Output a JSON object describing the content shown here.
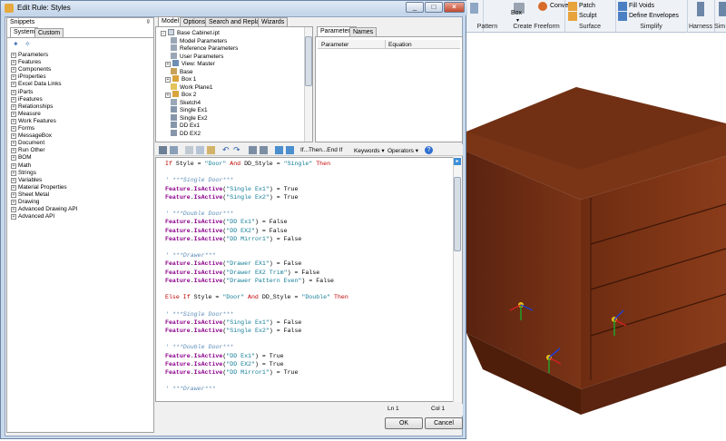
{
  "window": {
    "title": "Edit Rule: Styles"
  },
  "snippets": {
    "header": "Snippets",
    "tabs": [
      "System",
      "Custom"
    ],
    "items": [
      "Parameters",
      "Features",
      "Components",
      "iProperties",
      "Excel Data Links",
      "iParts",
      "iFeatures",
      "Relationships",
      "Measure",
      "Work Features",
      "Forms",
      "MessageBox",
      "Document",
      "Run Other",
      "BOM",
      "Math",
      "Strings",
      "Variables",
      "Material Properties",
      "Sheet Metal",
      "Drawing",
      "Advanced Drawing API",
      "Advanced API"
    ]
  },
  "main_tabs": [
    "Model",
    "Options",
    "Search and Replace",
    "Wizards"
  ],
  "model_tree": {
    "root": "Base Cabinet.ipt",
    "items": [
      "Model Parameters",
      "Reference Parameters",
      "User Parameters",
      "View: Master",
      "Base",
      "Box 1",
      "Work Plane1",
      "Box 2",
      "Sketch4",
      "Single Ex1",
      "Single Ex2",
      "DD Ex1",
      "DD EX2"
    ]
  },
  "param_panel": {
    "tabs": [
      "Parameters",
      "Names"
    ],
    "columns": [
      "Parameter",
      "Equation"
    ]
  },
  "toolbar": {
    "if_then": "If...Then...End If",
    "keywords": "Keywords",
    "operators": "Operators"
  },
  "code": [
    [
      [
        "kw",
        "If "
      ],
      [
        "plain",
        "Style = "
      ],
      [
        "str",
        "\"Door\""
      ],
      [
        "kw",
        " And "
      ],
      [
        "plain",
        "DD_Style = "
      ],
      [
        "str",
        "\"Single\""
      ],
      [
        "kw",
        " Then"
      ]
    ],
    [],
    [
      [
        "cmt",
        "' ***Single Door***"
      ]
    ],
    [
      [
        "obj",
        "Feature"
      ],
      [
        "plain",
        "."
      ],
      [
        "obj",
        "IsActive"
      ],
      [
        "plain",
        "("
      ],
      [
        "str",
        "\"Single Ex1\""
      ],
      [
        "plain",
        ") = True"
      ]
    ],
    [
      [
        "obj",
        "Feature"
      ],
      [
        "plain",
        "."
      ],
      [
        "obj",
        "IsActive"
      ],
      [
        "plain",
        "("
      ],
      [
        "str",
        "\"Single Ex2\""
      ],
      [
        "plain",
        ") = True"
      ]
    ],
    [],
    [
      [
        "cmt",
        "' ***Double Door***"
      ]
    ],
    [
      [
        "obj",
        "Feature"
      ],
      [
        "plain",
        "."
      ],
      [
        "obj",
        "IsActive"
      ],
      [
        "plain",
        "("
      ],
      [
        "str",
        "\"DD Ex1\""
      ],
      [
        "plain",
        ") = False"
      ]
    ],
    [
      [
        "obj",
        "Feature"
      ],
      [
        "plain",
        "."
      ],
      [
        "obj",
        "IsActive"
      ],
      [
        "plain",
        "("
      ],
      [
        "str",
        "\"DD EX2\""
      ],
      [
        "plain",
        ") = False"
      ]
    ],
    [
      [
        "obj",
        "Feature"
      ],
      [
        "plain",
        "."
      ],
      [
        "obj",
        "IsActive"
      ],
      [
        "plain",
        "("
      ],
      [
        "str",
        "\"DD Mirror1\""
      ],
      [
        "plain",
        ") = False"
      ]
    ],
    [],
    [
      [
        "cmt",
        "' ***Drawer***"
      ]
    ],
    [
      [
        "obj",
        "Feature"
      ],
      [
        "plain",
        "."
      ],
      [
        "obj",
        "IsActive"
      ],
      [
        "plain",
        "("
      ],
      [
        "str",
        "\"Drawer EX1\""
      ],
      [
        "plain",
        ") = False"
      ]
    ],
    [
      [
        "obj",
        "Feature"
      ],
      [
        "plain",
        "."
      ],
      [
        "obj",
        "IsActive"
      ],
      [
        "plain",
        "("
      ],
      [
        "str",
        "\"Drawer EX2 Trim\""
      ],
      [
        "plain",
        ") = False"
      ]
    ],
    [
      [
        "obj",
        "Feature"
      ],
      [
        "plain",
        "."
      ],
      [
        "obj",
        "IsActive"
      ],
      [
        "plain",
        "("
      ],
      [
        "str",
        "\"Drawer Pattern Even\""
      ],
      [
        "plain",
        ") = False"
      ]
    ],
    [],
    [
      [
        "kw",
        "Else If "
      ],
      [
        "plain",
        "Style = "
      ],
      [
        "str",
        "\"Door\""
      ],
      [
        "kw",
        " And "
      ],
      [
        "plain",
        "DD_Style = "
      ],
      [
        "str",
        "\"Double\""
      ],
      [
        "kw",
        " Then"
      ]
    ],
    [],
    [
      [
        "cmt",
        "' ***Single Door***"
      ]
    ],
    [
      [
        "obj",
        "Feature"
      ],
      [
        "plain",
        "."
      ],
      [
        "obj",
        "IsActive"
      ],
      [
        "plain",
        "("
      ],
      [
        "str",
        "\"Single Ex1\""
      ],
      [
        "plain",
        ") = False"
      ]
    ],
    [
      [
        "obj",
        "Feature"
      ],
      [
        "plain",
        "."
      ],
      [
        "obj",
        "IsActive"
      ],
      [
        "plain",
        "("
      ],
      [
        "str",
        "\"Single Ex2\""
      ],
      [
        "plain",
        ") = False"
      ]
    ],
    [],
    [
      [
        "cmt",
        "' ***Double Door***"
      ]
    ],
    [
      [
        "obj",
        "Feature"
      ],
      [
        "plain",
        "."
      ],
      [
        "obj",
        "IsActive"
      ],
      [
        "plain",
        "("
      ],
      [
        "str",
        "\"DD Ex1\""
      ],
      [
        "plain",
        ") = True"
      ]
    ],
    [
      [
        "obj",
        "Feature"
      ],
      [
        "plain",
        "."
      ],
      [
        "obj",
        "IsActive"
      ],
      [
        "plain",
        "("
      ],
      [
        "str",
        "\"DD EX2\""
      ],
      [
        "plain",
        ") = True"
      ]
    ],
    [
      [
        "obj",
        "Feature"
      ],
      [
        "plain",
        "."
      ],
      [
        "obj",
        "IsActive"
      ],
      [
        "plain",
        "("
      ],
      [
        "str",
        "\"DD Mirror1\""
      ],
      [
        "plain",
        ") = True"
      ]
    ],
    [],
    [
      [
        "cmt",
        "' ***Drawer***"
      ]
    ]
  ],
  "status": {
    "line": "Ln 1",
    "col": "Col 1"
  },
  "buttons": {
    "ok": "OK",
    "cancel": "Cancel"
  },
  "ribbon": {
    "items": [
      "Box",
      "Convert",
      "Patch",
      "Sculpt",
      "Fill Voids",
      "Define Envelopes"
    ],
    "groups": [
      "Pattern",
      "Create Freeform",
      "Surface",
      "Simplify",
      "Harness",
      "Sim"
    ]
  },
  "colors": {
    "cabinet": "#6b2a12",
    "editor_keyword": "#c00000",
    "editor_string": "#0f7c96",
    "editor_object": "#8b008b",
    "editor_comment": "#5c8bb8"
  }
}
